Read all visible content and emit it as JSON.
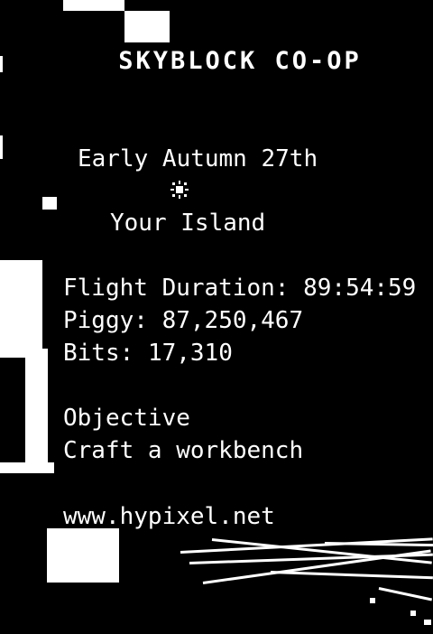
{
  "scoreboard": {
    "title": "SKYBLOCK CO-OP",
    "date": "Early Autumn 27th",
    "time_icon": "sun-icon",
    "location": "Your Island",
    "flight_label": "Flight Duration:",
    "flight_value": "89:54:59",
    "purse_label": "Piggy:",
    "purse_value": "87,250,467",
    "bits_label": "Bits:",
    "bits_value": "17,310",
    "objective_heading": "Objective",
    "objective_text": "Craft a workbench",
    "website": "www.hypixel.net"
  },
  "colors": {
    "background": "#000000",
    "text": "#ffffff"
  }
}
